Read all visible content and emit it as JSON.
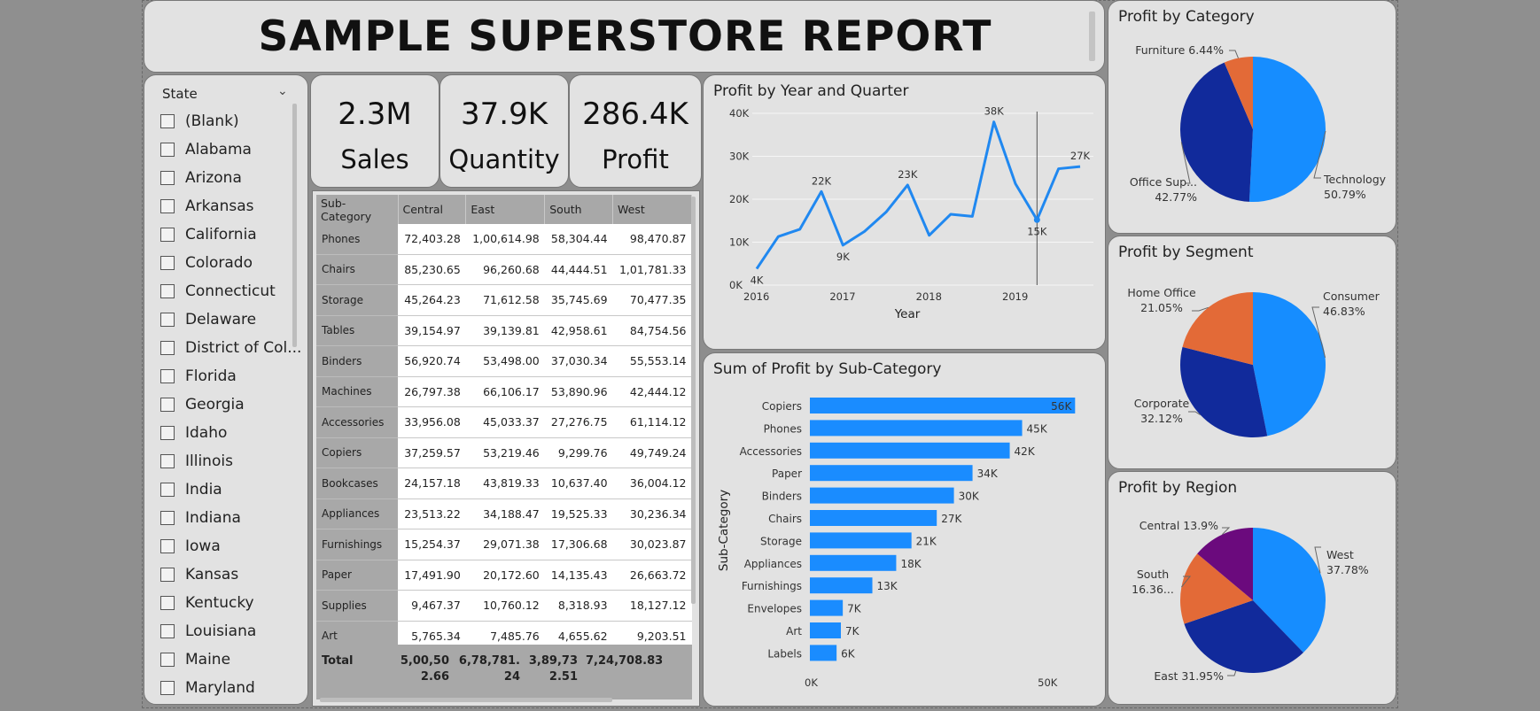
{
  "header": {
    "title": "SAMPLE SUPERSTORE REPORT"
  },
  "slicer": {
    "title": "State",
    "items": [
      "(Blank)",
      "Alabama",
      "Arizona",
      "Arkansas",
      "California",
      "Colorado",
      "Connecticut",
      "Delaware",
      "District of Col...",
      "Florida",
      "Georgia",
      "Idaho",
      "Illinois",
      "India",
      "Indiana",
      "Iowa",
      "Kansas",
      "Kentucky",
      "Louisiana",
      "Maine",
      "Maryland"
    ]
  },
  "kpis": [
    {
      "value": "2.3M",
      "label": "Sales"
    },
    {
      "value": "37.9K",
      "label": "Quantity"
    },
    {
      "value": "286.4K",
      "label": "Profit"
    }
  ],
  "matrix": {
    "columns": [
      "Sub-Category",
      "Central",
      "East",
      "South",
      "West"
    ],
    "rows": [
      [
        "Phones",
        "72,403.28",
        "1,00,614.98",
        "58,304.44",
        "98,470.87"
      ],
      [
        "Chairs",
        "85,230.65",
        "96,260.68",
        "44,444.51",
        "1,01,781.33"
      ],
      [
        "Storage",
        "45,264.23",
        "71,612.58",
        "35,745.69",
        "70,477.35"
      ],
      [
        "Tables",
        "39,154.97",
        "39,139.81",
        "42,958.61",
        "84,754.56"
      ],
      [
        "Binders",
        "56,920.74",
        "53,498.00",
        "37,030.34",
        "55,553.14"
      ],
      [
        "Machines",
        "26,797.38",
        "66,106.17",
        "53,890.96",
        "42,444.12"
      ],
      [
        "Accessories",
        "33,956.08",
        "45,033.37",
        "27,276.75",
        "61,114.12"
      ],
      [
        "Copiers",
        "37,259.57",
        "53,219.46",
        "9,299.76",
        "49,749.24"
      ],
      [
        "Bookcases",
        "24,157.18",
        "43,819.33",
        "10,637.40",
        "36,004.12"
      ],
      [
        "Appliances",
        "23,513.22",
        "34,188.47",
        "19,525.33",
        "30,236.34"
      ],
      [
        "Furnishings",
        "15,254.37",
        "29,071.38",
        "17,306.68",
        "30,023.87"
      ],
      [
        "Paper",
        "17,491.90",
        "20,172.60",
        "14,135.43",
        "26,663.72"
      ],
      [
        "Supplies",
        "9,467.37",
        "10,760.12",
        "8,318.93",
        "18,127.12"
      ],
      [
        "Art",
        "5,765.34",
        "7,485.76",
        "4,655.62",
        "9,203.51"
      ]
    ],
    "total": {
      "label": "Total",
      "central": "5,00,502.66",
      "east": "6,78,781.24",
      "south": "3,89,732.51",
      "west": "7,24,708.83"
    }
  },
  "chart_data": [
    {
      "type": "line",
      "title": "Profit by Year and Quarter",
      "xlabel": "Year",
      "ylabel": "",
      "x_ticks": [
        "2016",
        "2017",
        "2018",
        "2019"
      ],
      "y_ticks": [
        "0K",
        "10K",
        "20K",
        "30K",
        "40K"
      ],
      "ylim": [
        0,
        40000
      ],
      "color": "#2088f0",
      "x": [
        "2016 Q1",
        "2016 Q2",
        "2016 Q3",
        "2016 Q4",
        "2017 Q1",
        "2017 Q2",
        "2017 Q3",
        "2017 Q4",
        "2018 Q1",
        "2018 Q2",
        "2018 Q3",
        "2018 Q4",
        "2019 Q1",
        "2019 Q2",
        "2019 Q3",
        "2019 Q4"
      ],
      "values": [
        3800,
        11300,
        13000,
        21800,
        9300,
        12500,
        17000,
        23300,
        11600,
        16500,
        16000,
        38000,
        23600,
        15200,
        27100,
        27600
      ],
      "data_labels": [
        {
          "i": 0,
          "text": "4K"
        },
        {
          "i": 3,
          "text": "22K"
        },
        {
          "i": 4,
          "text": "9K"
        },
        {
          "i": 7,
          "text": "23K"
        },
        {
          "i": 11,
          "text": "38K"
        },
        {
          "i": 13,
          "text": "15K"
        },
        {
          "i": 15,
          "text": "27K"
        }
      ]
    },
    {
      "type": "bar",
      "orientation": "horizontal",
      "title": "Sum of Profit by Sub-Category",
      "ylabel": "Sub-Category",
      "x_ticks": [
        "0K",
        "50K"
      ],
      "xlim": [
        0,
        60000
      ],
      "color": "#1a8cff",
      "categories": [
        "Copiers",
        "Phones",
        "Accessories",
        "Paper",
        "Binders",
        "Chairs",
        "Storage",
        "Appliances",
        "Furnishings",
        "Envelopes",
        "Art",
        "Labels"
      ],
      "values": [
        55600,
        44500,
        41900,
        34100,
        30200,
        26600,
        21300,
        18100,
        13100,
        6900,
        6500,
        5600
      ],
      "data_labels": [
        "56K",
        "45K",
        "42K",
        "34K",
        "30K",
        "27K",
        "21K",
        "18K",
        "13K",
        "7K",
        "7K",
        "6K"
      ]
    },
    {
      "type": "pie",
      "title": "Profit by Category",
      "labels": [
        "Technology",
        "Office Sup...",
        "Furniture"
      ],
      "values": [
        50.79,
        42.77,
        6.44
      ],
      "colors": [
        "#168dff",
        "#112a9b",
        "#e36a37"
      ],
      "label_text": [
        [
          "Technology",
          "50.79%"
        ],
        [
          "Office Sup...",
          "42.77%"
        ],
        [
          "Furniture 6.44%"
        ]
      ]
    },
    {
      "type": "pie",
      "title": "Profit by Segment",
      "labels": [
        "Consumer",
        "Corporate",
        "Home Office"
      ],
      "values": [
        46.83,
        32.12,
        21.05
      ],
      "colors": [
        "#168dff",
        "#112a9b",
        "#e36a37"
      ],
      "label_text": [
        [
          "Consumer",
          "46.83%"
        ],
        [
          "Corporate",
          "32.12%"
        ],
        [
          "Home Office",
          "21.05%"
        ]
      ]
    },
    {
      "type": "pie",
      "title": "Profit by Region",
      "labels": [
        "West",
        "East",
        "South",
        "Central"
      ],
      "values": [
        37.78,
        31.95,
        16.36,
        13.9
      ],
      "colors": [
        "#168dff",
        "#112a9b",
        "#e36a37",
        "#6b0a7d"
      ],
      "label_text": [
        [
          "West",
          "37.78%"
        ],
        [
          "East 31.95%"
        ],
        [
          "South",
          "16.36..."
        ],
        [
          "Central 13.9%"
        ]
      ]
    }
  ]
}
